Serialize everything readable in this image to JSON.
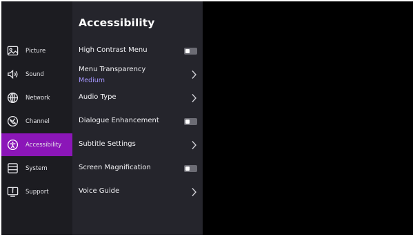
{
  "sidebar": {
    "items": [
      {
        "label": "Picture",
        "icon": "picture-icon",
        "active": false
      },
      {
        "label": "Sound",
        "icon": "speaker-icon",
        "active": false
      },
      {
        "label": "Network",
        "icon": "globe-icon",
        "active": false
      },
      {
        "label": "Channel",
        "icon": "satellite-icon",
        "active": false
      },
      {
        "label": "Accessibility",
        "icon": "accessibility-icon",
        "active": true
      },
      {
        "label": "System",
        "icon": "system-icon",
        "active": false
      },
      {
        "label": "Support",
        "icon": "support-icon",
        "active": false
      }
    ]
  },
  "main": {
    "title": "Accessibility",
    "rows": [
      {
        "label": "High Contrast Menu",
        "control": "toggle",
        "state": "off"
      },
      {
        "label": "Menu Transparency",
        "value": "Medium",
        "control": "chevron"
      },
      {
        "label": "Audio Type",
        "control": "chevron"
      },
      {
        "label": "Dialogue Enhancement",
        "control": "toggle",
        "state": "off"
      },
      {
        "label": "Subtitle Settings",
        "control": "chevron"
      },
      {
        "label": "Screen Magnification",
        "control": "toggle",
        "state": "off"
      },
      {
        "label": "Voice Guide",
        "control": "chevron"
      }
    ]
  },
  "colors": {
    "sidebar_bg": "#1c1c21",
    "content_bg": "#25252c",
    "active_bg": "#8b16b8",
    "value_text": "#a597ff",
    "toggle_off": "#6c6c74"
  }
}
